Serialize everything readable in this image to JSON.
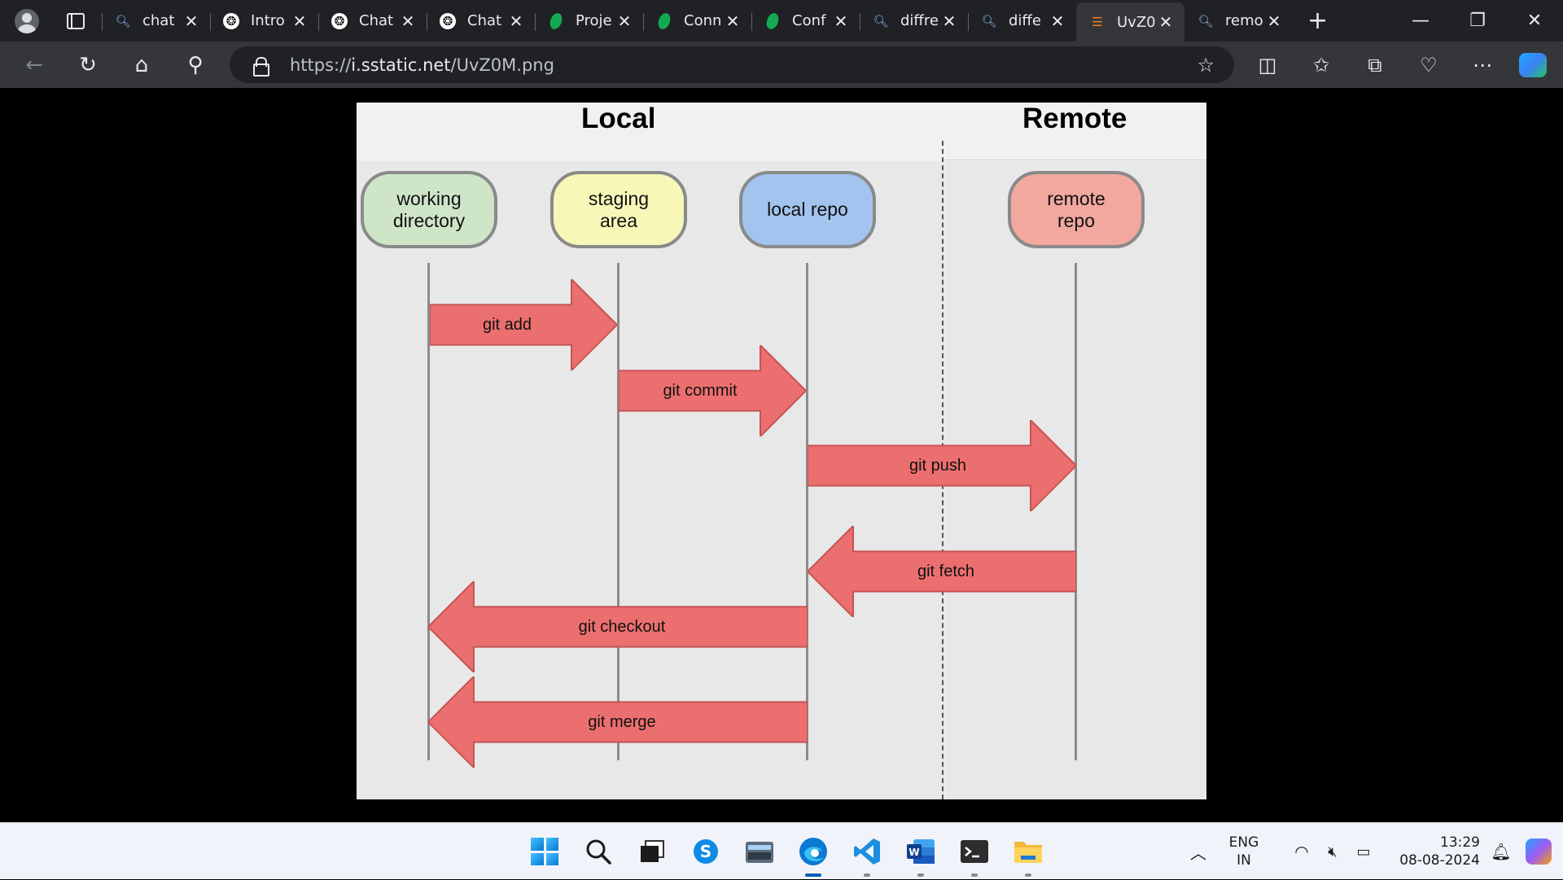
{
  "browser": {
    "tabs": [
      {
        "favicon": "search-icon",
        "title": "chat",
        "active": false
      },
      {
        "favicon": "chatgpt-icon",
        "title": "Intro",
        "active": false
      },
      {
        "favicon": "chatgpt-icon",
        "title": "Chat",
        "active": false
      },
      {
        "favicon": "chatgpt-icon",
        "title": "Chat",
        "active": false
      },
      {
        "favicon": "mongodb-leaf-icon",
        "title": "Proje",
        "active": false
      },
      {
        "favicon": "mongodb-leaf-icon",
        "title": "Conn",
        "active": false
      },
      {
        "favicon": "mongodb-leaf-icon",
        "title": "Conf",
        "active": false
      },
      {
        "favicon": "search-icon",
        "title": "diffre",
        "active": false
      },
      {
        "favicon": "search-icon",
        "title": "diffe",
        "active": false
      },
      {
        "favicon": "stackoverflow-icon",
        "title": "UvZ0",
        "active": true
      },
      {
        "favicon": "search-icon",
        "title": "remo",
        "active": false
      }
    ],
    "address_url": "https://i.sstatic.net/UvZ0M.png",
    "url_host": "i.sstatic.net",
    "url_scheme": "https://",
    "url_path": "/UvZ0M.png"
  },
  "diagram": {
    "regions": {
      "local": "Local",
      "remote": "Remote"
    },
    "nodes": {
      "working": {
        "line1": "working",
        "line2": "directory",
        "color": "#cfe5c8"
      },
      "staging": {
        "line1": "staging",
        "line2": "area",
        "color": "#f7f8b8"
      },
      "local_repo": {
        "line1": "local repo",
        "line2": "",
        "color": "#a3c4ef"
      },
      "remote_repo": {
        "line1": "remote",
        "line2": "repo",
        "color": "#f2a89f"
      }
    },
    "arrows": {
      "git_add": "git add",
      "git_commit": "git commit",
      "git_push": "git push",
      "git_fetch": "git fetch",
      "git_checkout": "git checkout",
      "git_merge": "git merge"
    },
    "arrow_color": "#ec6f6f"
  },
  "taskbar": {
    "language_line1": "ENG",
    "language_line2": "IN",
    "time": "13:29",
    "date": "08-08-2024"
  }
}
